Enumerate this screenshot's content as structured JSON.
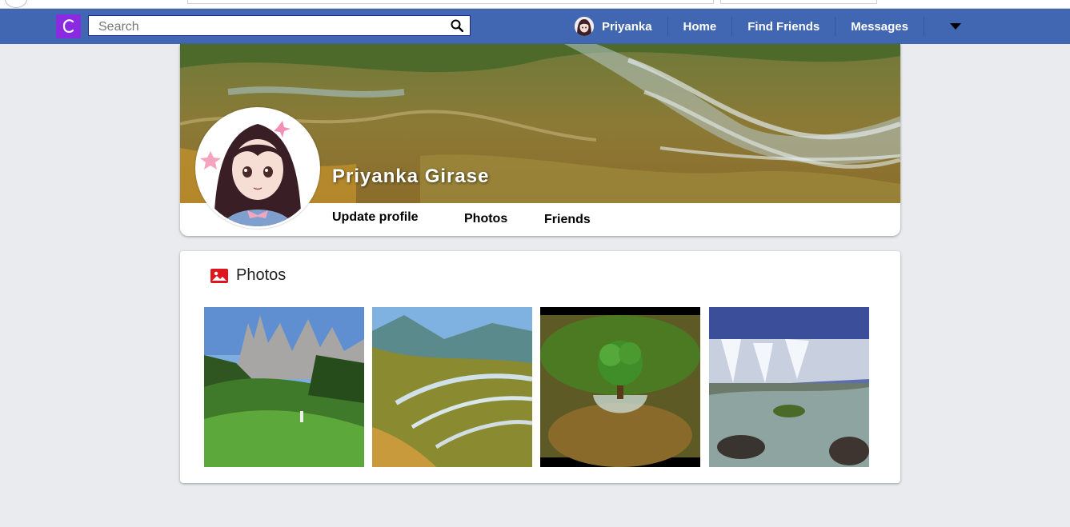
{
  "app": {
    "logo_letter": "C",
    "accent_color": "#4267b2",
    "logo_color": "#8a2be2"
  },
  "search": {
    "placeholder": "Search",
    "value": ""
  },
  "nav": {
    "user_name": "Priyanka",
    "items": [
      "Home",
      "Find Friends",
      "Messages"
    ],
    "icons": [
      "search-icon",
      "caret-down-icon"
    ]
  },
  "profile": {
    "name": "Priyanka Girase",
    "tabs": [
      "Update profile",
      "Photos",
      "Friends"
    ]
  },
  "photos": {
    "title": "Photos",
    "icon": "image-icon",
    "items": [
      "mountain-valley",
      "rice-terraces",
      "tree-sprout",
      "waterfall"
    ]
  }
}
